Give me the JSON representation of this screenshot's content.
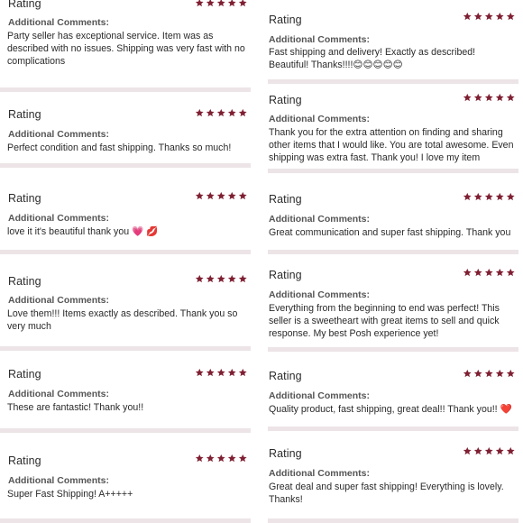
{
  "section_title": "Rating",
  "comments_label": "Additional Comments:",
  "star_color": "#7f1f32",
  "left_reviews": [
    {
      "title": "Rating",
      "stars": 5,
      "label": "Additional Comments:",
      "comment": "Party seller has exceptional service. Item was as\ndescribed with no issues. Shipping was very fast with no\ncomplications"
    },
    {
      "title": "Rating",
      "stars": 5,
      "label": "Additional Comments:",
      "comment": "Perfect condition and fast shipping. Thanks so much!"
    },
    {
      "title": "Rating",
      "stars": 5,
      "label": "Additional Comments:",
      "comment": "love it it's beautiful thank you 💗 💋"
    },
    {
      "title": "Rating",
      "stars": 5,
      "label": "Additional Comments:",
      "comment": "Love them!!! Items exactly as described. Thank you so\nvery much"
    },
    {
      "title": "Rating",
      "stars": 5,
      "label": "Additional Comments:",
      "comment": "These are fantastic! Thank you!!"
    },
    {
      "title": "Rating",
      "stars": 5,
      "label": "Additional Comments:",
      "comment": "Super Fast Shipping! A+++++"
    }
  ],
  "right_reviews": [
    {
      "title": "Rating",
      "stars": 5,
      "label": "Additional Comments:",
      "comment": "Fast shipping and delivery! Exactly as described!\nBeautiful! Thanks!!!!😊😊😊😊😊"
    },
    {
      "title": "Rating",
      "stars": 5,
      "label": "Additional Comments:",
      "comment": "Thank you for the extra attention on finding and sharing\nother items that I would like. You are total awesome. Even\nshipping was extra fast. Thank you! I love my item"
    },
    {
      "title": "Rating",
      "stars": 5,
      "label": "Additional Comments:",
      "comment": "Great communication and super fast shipping. Thank you"
    },
    {
      "title": "Rating",
      "stars": 5,
      "label": "Additional Comments:",
      "comment": "Everything from the beginning to end was perfect! This\nseller is a sweetheart with great items to sell and quick\nresponse. My best Posh experience yet!"
    },
    {
      "title": "Rating",
      "stars": 5,
      "label": "Additional Comments:",
      "comment": "Quality product, fast shipping, great deal!! Thank you!! ❤️"
    },
    {
      "title": "Rating",
      "stars": 5,
      "label": "Additional Comments:",
      "comment": "Great deal and super fast shipping! Everything is lovely.\nThanks!"
    }
  ]
}
